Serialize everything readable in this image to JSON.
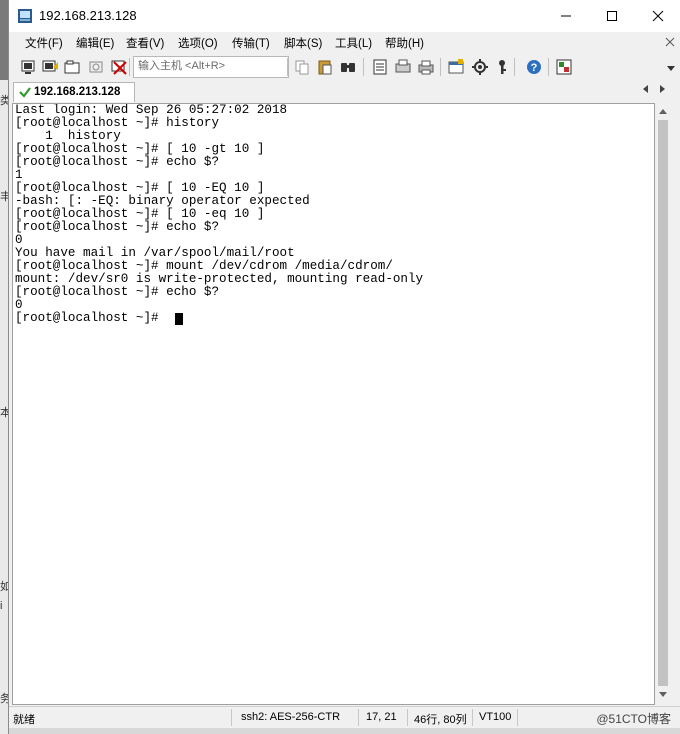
{
  "window": {
    "title": "192.168.213.128"
  },
  "menu": [
    "文件(F)",
    "编辑(E)",
    "查看(V)",
    "选项(O)",
    "传输(T)",
    "脚本(S)",
    "工具(L)",
    "帮助(H)"
  ],
  "toolbar": {
    "host_placeholder": "输入主机 <Alt+R>",
    "icons_left": [
      "connect-icon",
      "quick-connect-icon",
      "connect-tab-icon",
      "reconnect-icon",
      "disconnect-icon"
    ],
    "icons_right": [
      "copy-icon",
      "paste-icon",
      "find-icon",
      "print-icon",
      "print-setup-icon",
      "printer-icon",
      "session-options-icon",
      "global-options-icon",
      "keymap-icon",
      "help-icon",
      "sftp-icon"
    ]
  },
  "tab": {
    "label": "192.168.213.128"
  },
  "terminal": {
    "lines": [
      "Last login: Wed Sep 26 05:27:02 2018",
      "[root@localhost ~]# history",
      "    1  history",
      "[root@localhost ~]# [ 10 -gt 10 ]",
      "[root@localhost ~]# echo $?",
      "1",
      "[root@localhost ~]# [ 10 -EQ 10 ]",
      "-bash: [: -EQ: binary operator expected",
      "[root@localhost ~]# [ 10 -eq 10 ]",
      "[root@localhost ~]# echo $?",
      "0",
      "You have mail in /var/spool/mail/root",
      "[root@localhost ~]# mount /dev/cdrom /media/cdrom/",
      "mount: /dev/sr0 is write-protected, mounting read-only",
      "[root@localhost ~]# echo $?",
      "0",
      "[root@localhost ~]# "
    ]
  },
  "status": {
    "ready": "就绪",
    "cipher": "ssh2: AES-256-CTR",
    "cursor_pos": "17,  21",
    "size": "46行, 80列",
    "emulation": "VT100",
    "watermark": "@51CTO博客"
  },
  "background_fragments": [
    "类",
    "丰",
    "本",
    "如",
    "i",
    "务"
  ]
}
